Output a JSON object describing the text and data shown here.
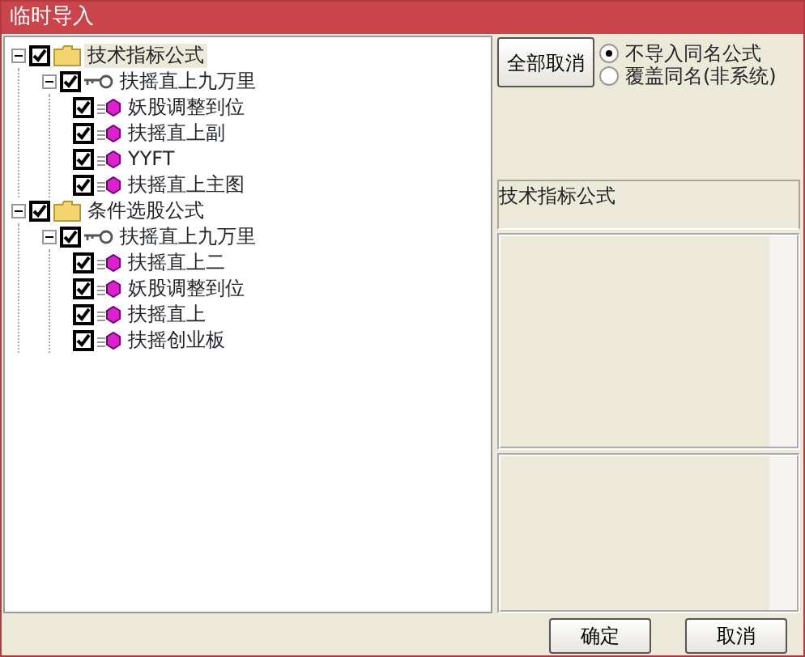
{
  "window": {
    "title": "临时导入"
  },
  "tree": [
    {
      "label": "技术指标公式",
      "kind": "folder",
      "checked": true,
      "expanded": true,
      "selected": true,
      "children": [
        {
          "label": "扶摇直上九万里",
          "kind": "group",
          "checked": true,
          "expanded": true,
          "selected": false,
          "children": [
            {
              "label": "妖股调整到位",
              "kind": "formula",
              "checked": true,
              "selected": false
            },
            {
              "label": "扶摇直上副",
              "kind": "formula",
              "checked": true,
              "selected": false
            },
            {
              "label": "YYFT",
              "kind": "formula",
              "checked": true,
              "selected": false
            },
            {
              "label": "扶摇直上主图",
              "kind": "formula",
              "checked": true,
              "selected": false
            }
          ]
        }
      ]
    },
    {
      "label": "条件选股公式",
      "kind": "folder",
      "checked": true,
      "expanded": true,
      "selected": false,
      "children": [
        {
          "label": "扶摇直上九万里",
          "kind": "group",
          "checked": true,
          "expanded": true,
          "selected": false,
          "children": [
            {
              "label": "扶摇直上二",
              "kind": "formula",
              "checked": true,
              "selected": false
            },
            {
              "label": "妖股调整到位",
              "kind": "formula",
              "checked": true,
              "selected": false
            },
            {
              "label": "扶摇直上",
              "kind": "formula",
              "checked": true,
              "selected": false
            },
            {
              "label": "扶摇创业板",
              "kind": "formula",
              "checked": true,
              "selected": false
            }
          ]
        }
      ]
    }
  ],
  "deselect_all_button": "全部取消",
  "options": [
    {
      "label": "不导入同名公式",
      "selected": true
    },
    {
      "label": "覆盖同名(非系统)",
      "selected": false
    }
  ],
  "info_label": "技术指标公式",
  "buttons": [
    "确定",
    "取消"
  ]
}
